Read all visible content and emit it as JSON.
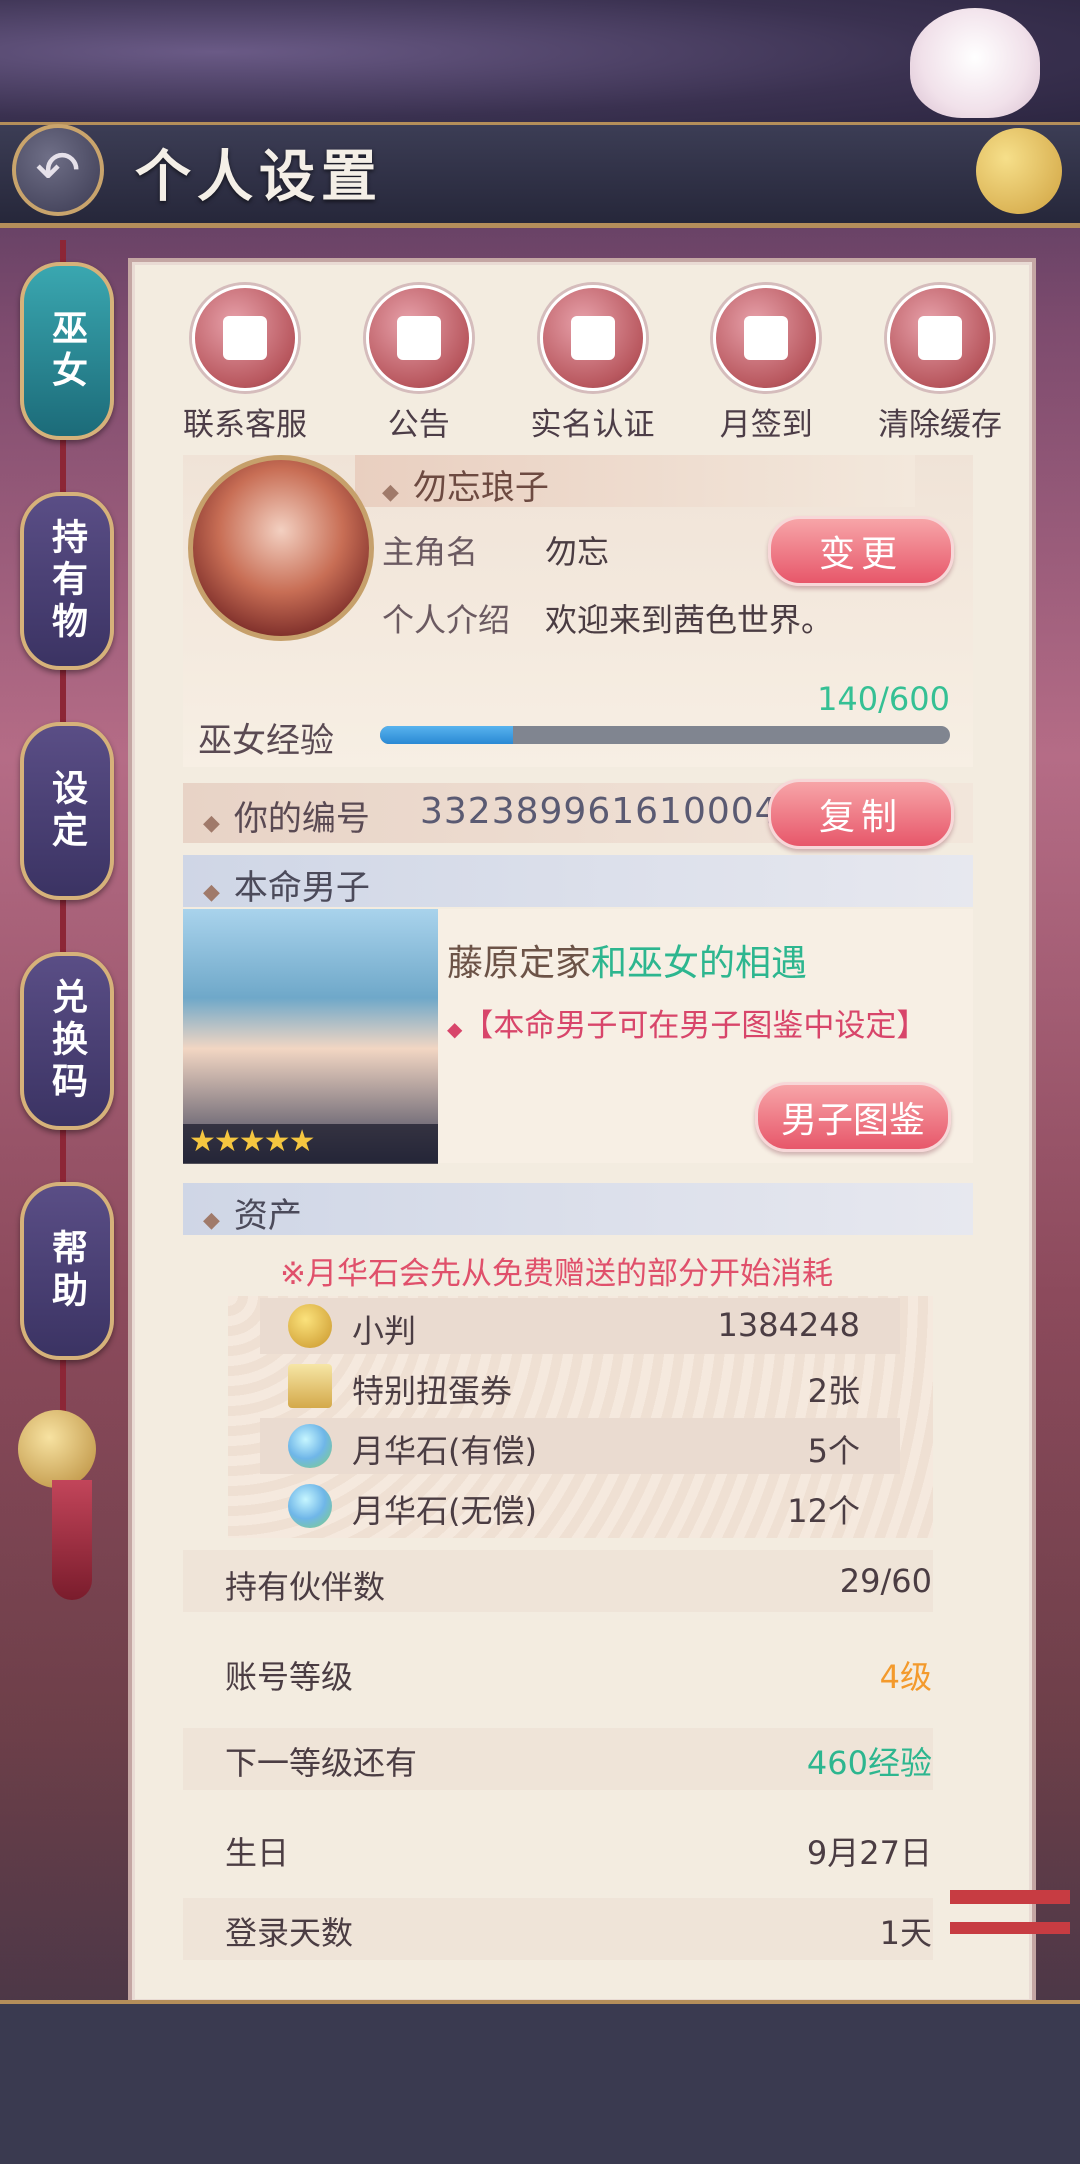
{
  "header": {
    "title": "个人设置",
    "back_icon": "back-arrow-icon"
  },
  "side_tabs": [
    {
      "label": "巫女",
      "active": true
    },
    {
      "label": "持有物",
      "active": false
    },
    {
      "label": "设定",
      "active": false
    },
    {
      "label": "兑换码",
      "active": false
    },
    {
      "label": "帮助",
      "active": false
    }
  ],
  "quick_actions": [
    {
      "label": "联系客服",
      "icon": "customer-service-icon"
    },
    {
      "label": "公告",
      "icon": "notice-icon"
    },
    {
      "label": "实名认证",
      "icon": "verification-icon"
    },
    {
      "label": "月签到",
      "icon": "calendar-icon"
    },
    {
      "label": "清除缓存",
      "icon": "broom-icon"
    }
  ],
  "profile": {
    "title_name": "勿忘琅子",
    "hero_label": "主角名",
    "hero_name": "勿忘",
    "change_btn": "变更",
    "intro_label": "个人介绍",
    "intro": "欢迎来到茜色世界。",
    "exp_label": "巫女经验",
    "exp_text": "140/600",
    "exp_fraction": 0.233
  },
  "id_row": {
    "label": "你的编号",
    "value": "332389961610004",
    "copy_btn": "复制"
  },
  "destined": {
    "section_title": "本命男子",
    "name": "藤原定家",
    "name_suffix": "和巫女的相遇",
    "hint": "【本命男子可在男子图鉴中设定】",
    "stars": "★★★★★",
    "button": "男子图鉴"
  },
  "assets": {
    "section_title": "资产",
    "note": "※月华石会先从免费赠送的部分开始消耗",
    "items": [
      {
        "name": "小判",
        "value": "1384248",
        "icon": "gold-coin-icon"
      },
      {
        "name": "特别扭蛋券",
        "value": "2张",
        "icon": "gacha-ticket-icon"
      },
      {
        "name": "月华石(有偿)",
        "value": "5个",
        "icon": "moonstone-icon"
      },
      {
        "name": "月华石(无偿)",
        "value": "12个",
        "icon": "moonstone-icon"
      }
    ]
  },
  "stats": [
    {
      "label": "持有伙伴数",
      "value": "29/60",
      "color": "#4b3d43"
    },
    {
      "label": "账号等级",
      "value": "4级",
      "color": "#f39a2c"
    },
    {
      "label": "下一等级还有",
      "value": "460经验",
      "color": "#2db68f"
    },
    {
      "label": "生日",
      "value": "9月27日",
      "color": "#4b3d43"
    },
    {
      "label": "登录天数",
      "value": "1天",
      "color": "#4b3d43"
    }
  ]
}
